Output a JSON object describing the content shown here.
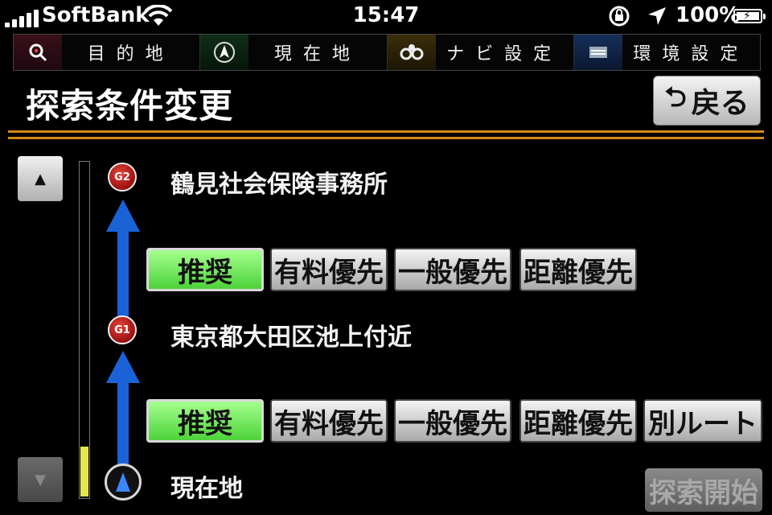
{
  "status": {
    "carrier": "SoftBank",
    "time": "15:47",
    "battery": "100%",
    "battery_level": 1.0
  },
  "nav": {
    "items": [
      {
        "label": "目的地",
        "icon": "search-icon"
      },
      {
        "label": "現在地",
        "icon": "compass-icon"
      },
      {
        "label": "ナビ設定",
        "icon": "gear-icon"
      },
      {
        "label": "環境設定",
        "icon": "settings-icon"
      }
    ]
  },
  "page": {
    "title": "探索条件変更",
    "back_label": "戻る",
    "start_label": "探索開始"
  },
  "route": {
    "markers": {
      "g2": "G2",
      "g1": "G1"
    },
    "points": {
      "g2": "鶴見社会保険事務所",
      "g1": "東京都大田区池上付近",
      "current": "現在地"
    },
    "segment1_options": [
      "推奨",
      "有料優先",
      "一般優先",
      "距離優先"
    ],
    "segment2_options": [
      "推奨",
      "有料優先",
      "一般優先",
      "距離優先",
      "別ルート"
    ],
    "selected": "推奨"
  },
  "scroll": {
    "up": "▲",
    "down": "▼",
    "position": 0.15
  },
  "colors": {
    "accent": "#d58a1a",
    "route": "#1a63d6",
    "selected": "#5ee04a"
  }
}
